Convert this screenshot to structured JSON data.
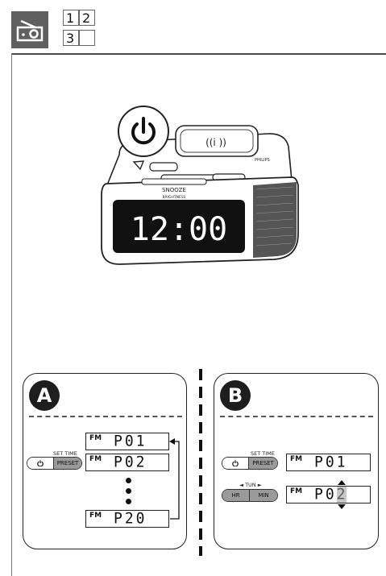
{
  "header": {
    "icon": "radio-icon",
    "section_cells": [
      "1",
      "2",
      "3",
      ""
    ]
  },
  "product": {
    "brand": "PHILIPS",
    "clock_display": "12:00",
    "snooze_label": "SNOOZE",
    "brightness_label": "BRIGHTNESS",
    "callout_icon": "power-icon"
  },
  "panel_a": {
    "badge": "A",
    "set_time_label": "SET TIME",
    "power_icon": "power-icon",
    "preset_label": "PRESET",
    "band": "FM",
    "presets": [
      "P01",
      "P02",
      "P20"
    ]
  },
  "panel_b": {
    "badge": "B",
    "set_time_label": "SET TIME",
    "power_icon": "power-icon",
    "preset_label": "PRESET",
    "tun_label": "◄ TUN ►",
    "hr_label": "HR",
    "min_label": "MIN",
    "band": "FM",
    "displays": [
      "P01",
      "P02"
    ]
  },
  "colors": {
    "header_bg": "#5f5f5f",
    "button_fill": "#9a9a9a",
    "device_body": "#ffffff",
    "clock_face": "#111111"
  }
}
